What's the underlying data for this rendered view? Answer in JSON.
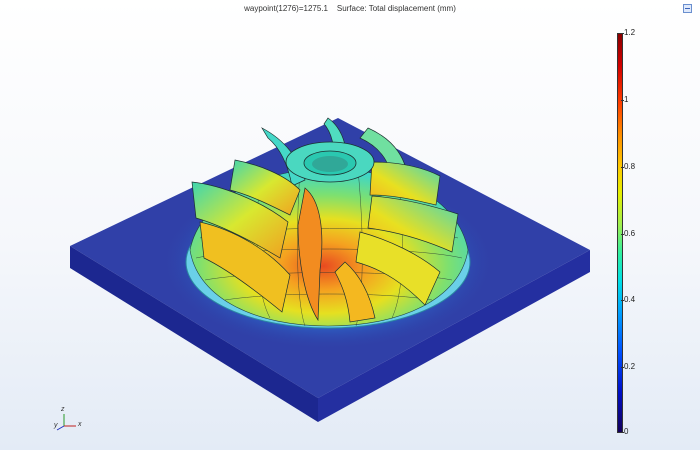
{
  "view": {
    "title": "waypoint(1276)=1275.1    Surface: Total displacement (mm)"
  },
  "colorbar": {
    "ticks": [
      "1.2",
      "1",
      "0.8",
      "0.6",
      "0.4",
      "0.2",
      "0"
    ],
    "colors": {
      "low": "#14005a",
      "mid": "#00e0e6",
      "high": "#8c0000"
    }
  },
  "axes": {
    "x": "x",
    "y": "y",
    "z": "z"
  },
  "scene": {
    "base_color": "#2d3aa0",
    "glow_color": "#4fd0ff"
  },
  "icons": {
    "corner": "minimize-icon"
  }
}
